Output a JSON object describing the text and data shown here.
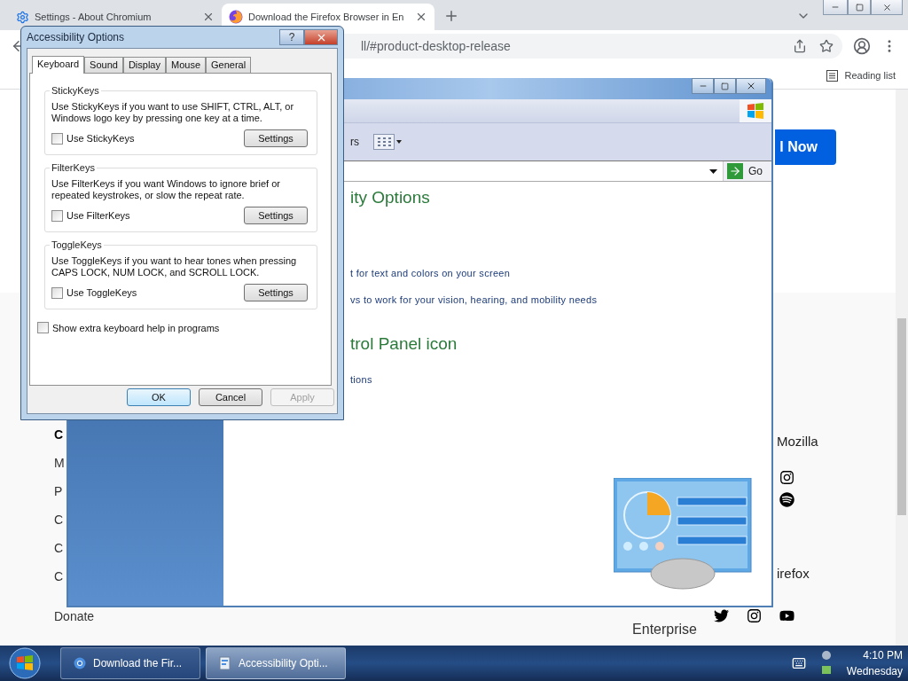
{
  "browser": {
    "tabs": [
      {
        "title": "Settings - About Chromium",
        "selected": false
      },
      {
        "title": "Download the Firefox Browser in En",
        "selected": true
      }
    ],
    "url": "ll/#product-desktop-release",
    "reading_list": "Reading list",
    "page": {
      "cta": "l Now",
      "footer_left": [
        {
          "kind": "heading",
          "text": "C"
        },
        {
          "kind": "link",
          "text": "M"
        },
        {
          "kind": "link",
          "text": "P"
        },
        {
          "kind": "link",
          "text": "C"
        },
        {
          "kind": "link",
          "text": "C"
        },
        {
          "kind": "link",
          "text": "C"
        },
        {
          "kind": "link",
          "text": "Donate"
        }
      ],
      "footer_middle": "Enterprise",
      "footer_right": [
        "Mozilla",
        "irefox"
      ]
    }
  },
  "control_panel": {
    "toolbar_text": "rs",
    "go": "Go",
    "content": [
      {
        "kind": "heading",
        "text": "ity Options"
      },
      {
        "kind": "link",
        "text": "t for text and colors on your screen"
      },
      {
        "kind": "link",
        "text": "vs to work for your vision, hearing, and mobility needs"
      },
      {
        "kind": "heading",
        "text": "trol Panel icon"
      },
      {
        "kind": "link",
        "text": "tions"
      }
    ]
  },
  "dialog": {
    "title": "Accessibility Options",
    "help": "?",
    "tabs": [
      {
        "label": "Keyboard",
        "selected": true
      },
      {
        "label": "Sound",
        "selected": false
      },
      {
        "label": "Display",
        "selected": false
      },
      {
        "label": "Mouse",
        "selected": false
      },
      {
        "label": "General",
        "selected": false
      }
    ],
    "groups": [
      {
        "title": "StickyKeys",
        "description": "Use StickyKeys if you want to use SHIFT, CTRL, ALT, or Windows logo key by pressing one key at a time.",
        "checkbox": "Use StickyKeys",
        "checked": false,
        "button": "Settings"
      },
      {
        "title": "FilterKeys",
        "description": "Use FilterKeys if you want Windows to ignore brief or repeated keystrokes, or slow the repeat rate.",
        "checkbox": "Use FilterKeys",
        "checked": false,
        "button": "Settings"
      },
      {
        "title": "ToggleKeys",
        "description": "Use ToggleKeys if you want to hear tones when pressing CAPS LOCK, NUM LOCK, and SCROLL LOCK.",
        "checkbox": "Use ToggleKeys",
        "checked": false,
        "button": "Settings"
      }
    ],
    "extra": {
      "label": "Show extra keyboard help in programs",
      "checked": false
    },
    "buttons": [
      {
        "label": "OK",
        "default": true,
        "disabled": false
      },
      {
        "label": "Cancel",
        "default": false,
        "disabled": false
      },
      {
        "label": "Apply",
        "default": false,
        "disabled": true
      }
    ]
  },
  "taskbar": {
    "tasks": [
      {
        "label": "Download the Fir...",
        "selected": false
      },
      {
        "label": "Accessibility Opti...",
        "selected": true
      }
    ],
    "time": "4:10 PM",
    "day": "Wednesday"
  }
}
